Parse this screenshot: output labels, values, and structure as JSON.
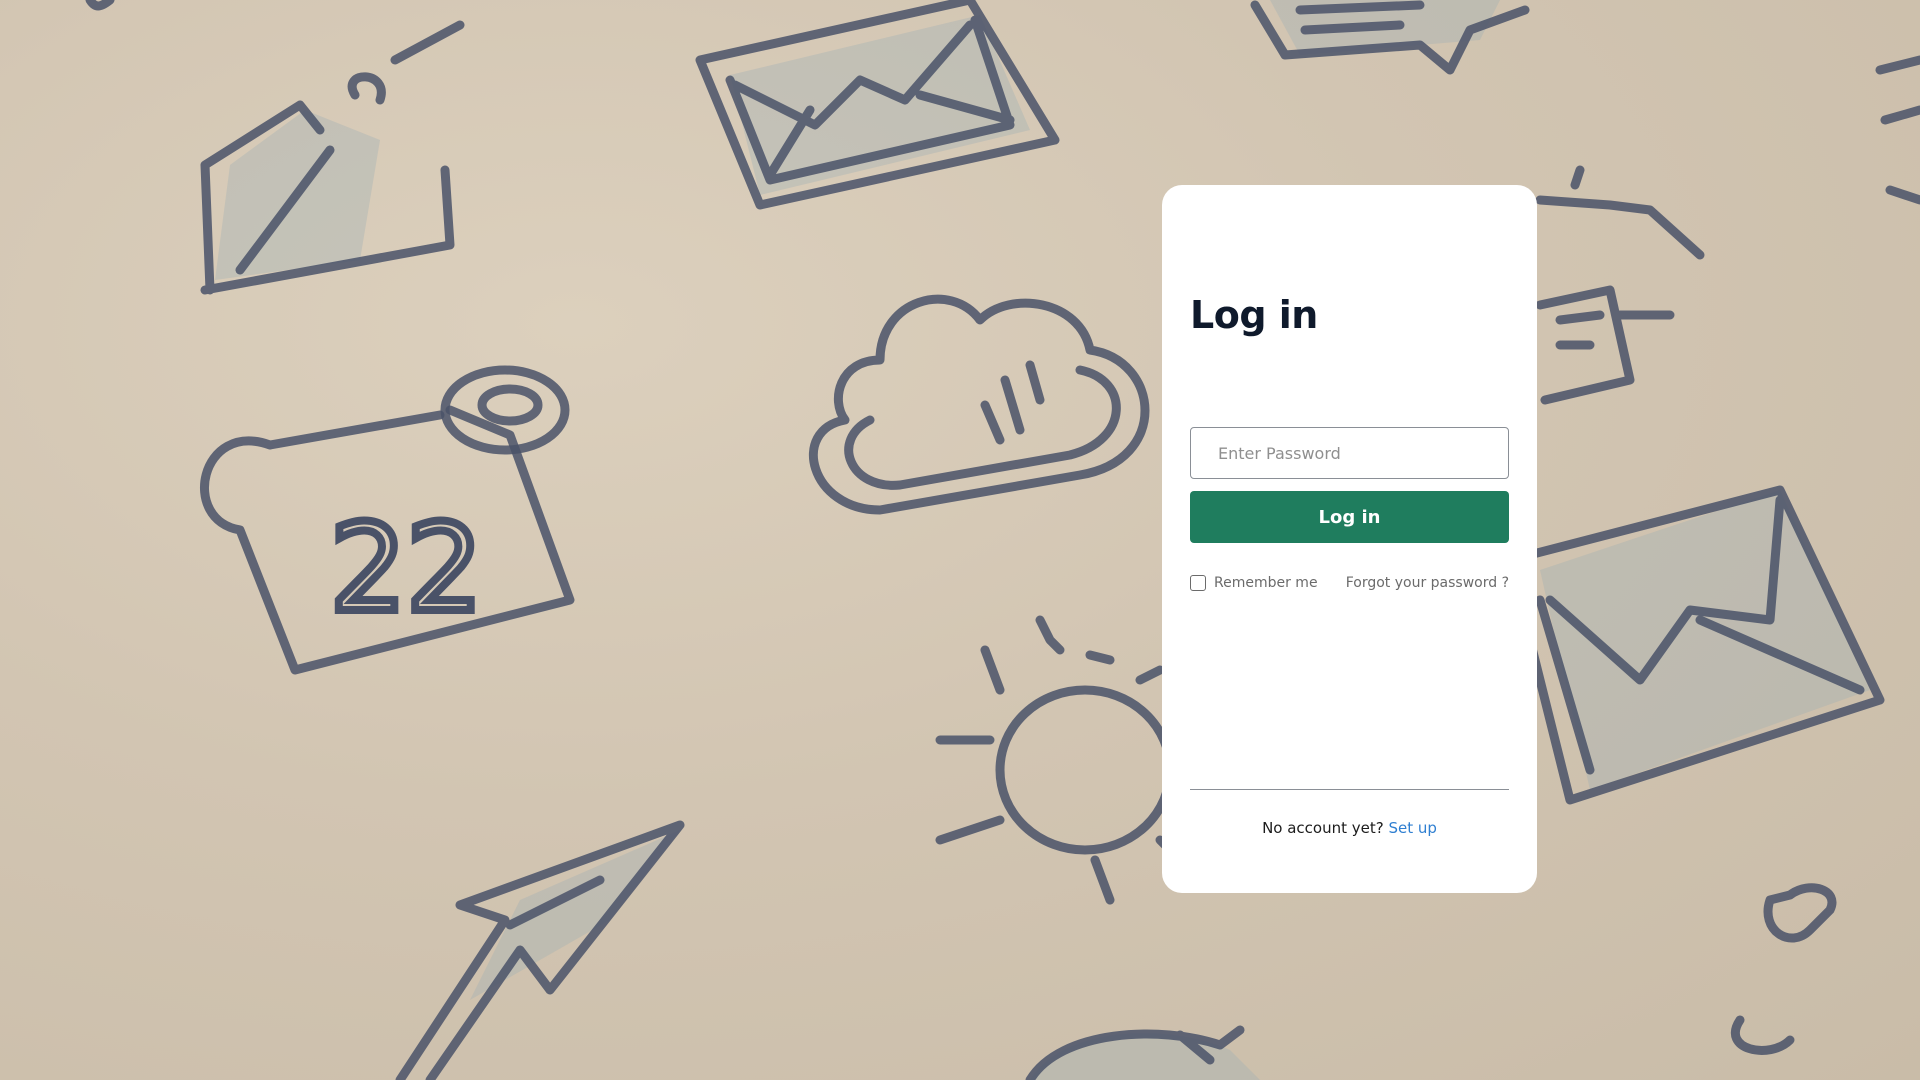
{
  "login": {
    "title": "Log in",
    "password_placeholder": "Enter Password",
    "submit_label": "Log in",
    "remember_label": "Remember me",
    "remember_checked": false,
    "forgot_label": "Forgot your password ?",
    "no_account_text": "No account yet?",
    "setup_label": "Set up"
  },
  "colors": {
    "primary_button": "#1f7d5e",
    "link": "#2f7fd1",
    "title": "#0f1a2c"
  },
  "background": {
    "icons": [
      "house-doodle-icon",
      "envelope-doodle-icon",
      "chat-bubble-doodle-icon",
      "calendar-doodle-icon",
      "cloud-doodle-icon",
      "sun-doodle-icon",
      "pencil-doodle-icon",
      "person-doodle-icon"
    ],
    "calendar_day": "22"
  }
}
